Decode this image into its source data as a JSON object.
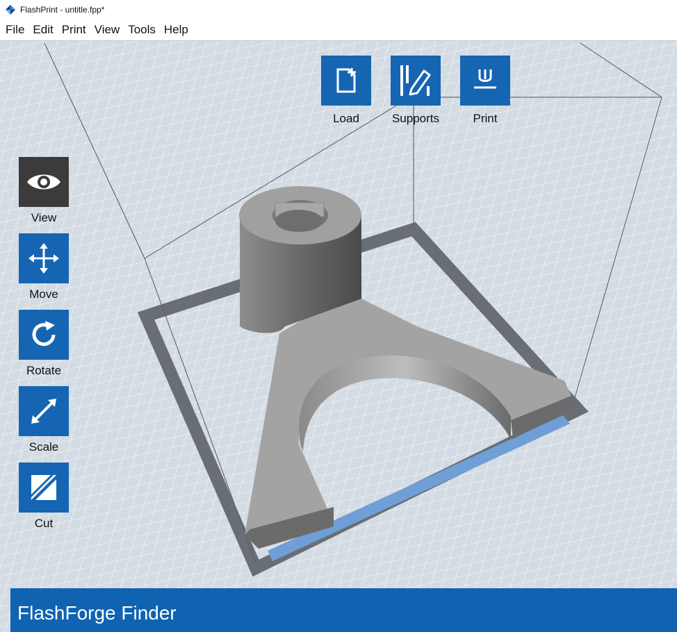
{
  "window": {
    "title": "FlashPrint - untitle.fpp*",
    "app_icon": "flashprint-diamond-icon"
  },
  "menu": [
    {
      "label": "File"
    },
    {
      "label": "Edit"
    },
    {
      "label": "Print"
    },
    {
      "label": "View"
    },
    {
      "label": "Tools"
    },
    {
      "label": "Help"
    }
  ],
  "top_toolbar": {
    "load": {
      "label": "Load",
      "icon": "add-file-icon"
    },
    "supports": {
      "label": "Supports",
      "icon": "pencil-supports-icon"
    },
    "print": {
      "label": "Print",
      "icon": "print-nozzle-icon"
    }
  },
  "left_toolbar": {
    "view": {
      "label": "View",
      "icon": "eye-icon",
      "active": true
    },
    "move": {
      "label": "Move",
      "icon": "move-arrows-icon"
    },
    "rotate": {
      "label": "Rotate",
      "icon": "rotate-icon"
    },
    "scale": {
      "label": "Scale",
      "icon": "scale-arrow-icon"
    },
    "cut": {
      "label": "Cut",
      "icon": "cut-icon"
    }
  },
  "status": {
    "printer_finder": "FlashForge Finder"
  },
  "colors": {
    "accent_blue": "#1565b3",
    "active_tool": "#3b3b3b",
    "grid_background": "#d6dde5",
    "model_gray": "#9a9a9a",
    "footer_blue": "#0f63b0"
  }
}
